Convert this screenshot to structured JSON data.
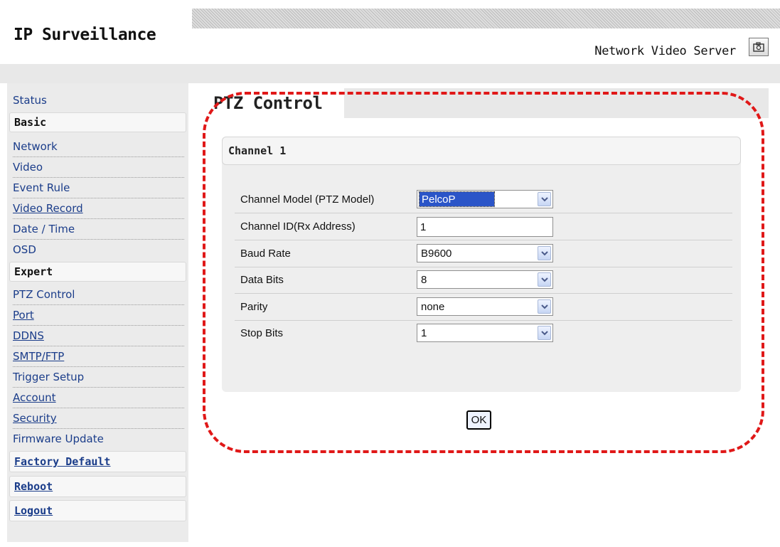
{
  "header": {
    "app_title": "IP Surveillance",
    "device_name": "Network Video Server",
    "snapshot_icon": "camera-icon"
  },
  "sidebar": {
    "status": "Status",
    "basic": "Basic",
    "basic_items": [
      "Network",
      "Video",
      "Event Rule",
      "Video Record",
      "Date / Time",
      "OSD"
    ],
    "expert": "Expert",
    "expert_items": [
      "PTZ Control",
      "Port",
      "DDNS",
      "SMTP/FTP",
      "Trigger Setup",
      "Account",
      "Security",
      "Firmware Update"
    ],
    "factory_default": "Factory Default",
    "reboot": "Reboot",
    "logout": "Logout"
  },
  "main": {
    "page_title": "PTZ Control",
    "panel_title": "Channel 1",
    "fields": [
      {
        "label": "Channel Model (PTZ Model)",
        "value": "PelcoP",
        "type": "select"
      },
      {
        "label": "Channel ID(Rx Address)",
        "value": "1",
        "type": "text"
      },
      {
        "label": "Baud Rate",
        "value": "B9600",
        "type": "select"
      },
      {
        "label": "Data Bits",
        "value": "8",
        "type": "select"
      },
      {
        "label": "Parity",
        "value": "none",
        "type": "select"
      },
      {
        "label": "Stop Bits",
        "value": "1",
        "type": "select"
      }
    ],
    "ok_label": "OK"
  },
  "colors": {
    "link": "#1b3d8a",
    "highlight": "#e01818",
    "selected": "#2b55c8"
  }
}
